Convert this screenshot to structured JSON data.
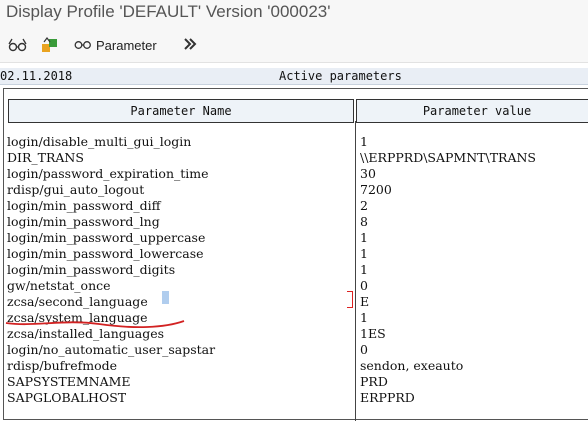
{
  "window": {
    "title": "Display Profile 'DEFAULT' Version '000023'"
  },
  "toolbar": {
    "icons": [
      "glasses-icon",
      "change-icon"
    ],
    "parameter_label": "Parameter",
    "more_icon": "double-chevron-right-icon"
  },
  "infobar": {
    "date": "02.11.2018",
    "heading": "Active parameters"
  },
  "table": {
    "headers": {
      "name": "Parameter Name",
      "value": "Parameter value"
    },
    "rows": [
      {
        "name": "login/disable_multi_gui_login",
        "value": "1"
      },
      {
        "name": "DIR_TRANS",
        "value": "\\\\ERPPRD\\SAPMNT\\TRANS"
      },
      {
        "name": "login/password_expiration_time",
        "value": "30"
      },
      {
        "name": "rdisp/gui_auto_logout",
        "value": "7200"
      },
      {
        "name": "login/min_password_diff",
        "value": "2"
      },
      {
        "name": "login/min_password_lng",
        "value": "8"
      },
      {
        "name": "login/min_password_uppercase",
        "value": "1"
      },
      {
        "name": "login/min_password_lowercase",
        "value": "1"
      },
      {
        "name": "login/min_password_digits",
        "value": "1"
      },
      {
        "name": "gw/netstat_once",
        "value": "0"
      },
      {
        "name": "zcsa/second_language",
        "value": "E"
      },
      {
        "name": "zcsa/system_language",
        "value": "1"
      },
      {
        "name": "zcsa/installed_languages",
        "value": "1ES"
      },
      {
        "name": "login/no_automatic_user_sapstar",
        "value": "0"
      },
      {
        "name": "rdisp/bufrefmode",
        "value": "sendon, exeauto"
      },
      {
        "name": "SAPSYSTEMNAME",
        "value": "PRD"
      },
      {
        "name": "SAPGLOBALHOST",
        "value": "ERPPRD"
      }
    ]
  },
  "colors": {
    "annotation": "#d22222",
    "selection": "#9cc1ea"
  }
}
